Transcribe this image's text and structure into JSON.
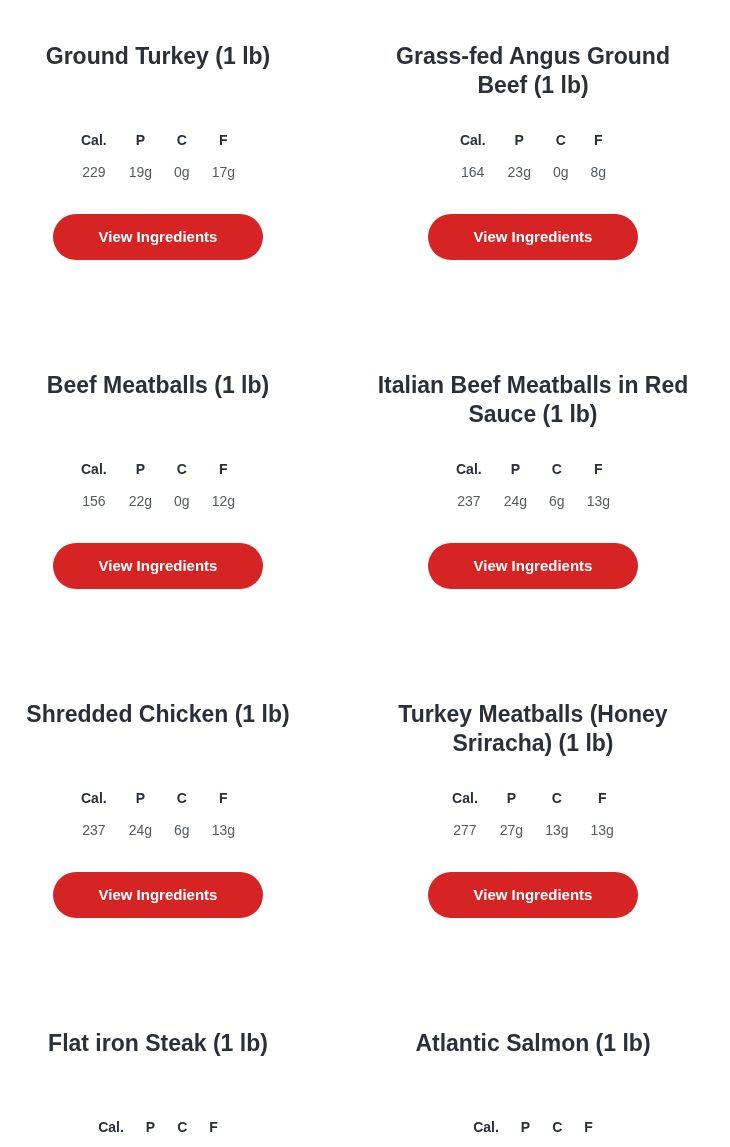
{
  "products": [
    {
      "title": "Ground Turkey (1 lb)",
      "nutrition": [
        {
          "label": "Cal.",
          "value": "229"
        },
        {
          "label": "P",
          "value": "19g"
        },
        {
          "label": "C",
          "value": "0g"
        },
        {
          "label": "F",
          "value": "17g"
        }
      ],
      "button": "View Ingredients"
    },
    {
      "title": "Grass-fed Angus Ground Beef (1 lb)",
      "nutrition": [
        {
          "label": "Cal.",
          "value": "164"
        },
        {
          "label": "P",
          "value": "23g"
        },
        {
          "label": "C",
          "value": "0g"
        },
        {
          "label": "F",
          "value": "8g"
        }
      ],
      "button": "View Ingredients"
    },
    {
      "title": "Beef Meatballs (1 lb)",
      "nutrition": [
        {
          "label": "Cal.",
          "value": "156"
        },
        {
          "label": "P",
          "value": "22g"
        },
        {
          "label": "C",
          "value": "0g"
        },
        {
          "label": "F",
          "value": "12g"
        }
      ],
      "button": "View Ingredients"
    },
    {
      "title": "Italian Beef Meatballs in Red Sauce (1 lb)",
      "nutrition": [
        {
          "label": "Cal.",
          "value": "237"
        },
        {
          "label": "P",
          "value": "24g"
        },
        {
          "label": "C",
          "value": "6g"
        },
        {
          "label": "F",
          "value": "13g"
        }
      ],
      "button": "View Ingredients"
    },
    {
      "title": "Shredded Chicken (1 lb)",
      "nutrition": [
        {
          "label": "Cal.",
          "value": "237"
        },
        {
          "label": "P",
          "value": "24g"
        },
        {
          "label": "C",
          "value": "6g"
        },
        {
          "label": "F",
          "value": "13g"
        }
      ],
      "button": "View Ingredients"
    },
    {
      "title": "Turkey Meatballs (Honey Sriracha) (1 lb)",
      "nutrition": [
        {
          "label": "Cal.",
          "value": "277"
        },
        {
          "label": "P",
          "value": "27g"
        },
        {
          "label": "C",
          "value": "13g"
        },
        {
          "label": "F",
          "value": "13g"
        }
      ],
      "button": "View Ingredients"
    },
    {
      "title": "Flat iron Steak (1 lb)",
      "nutrition": [
        {
          "label": "Cal."
        },
        {
          "label": "P"
        },
        {
          "label": "C"
        },
        {
          "label": "F"
        }
      ]
    },
    {
      "title": "Atlantic Salmon (1 lb)",
      "nutrition": [
        {
          "label": "Cal."
        },
        {
          "label": "P"
        },
        {
          "label": "C"
        },
        {
          "label": "F"
        }
      ]
    }
  ]
}
